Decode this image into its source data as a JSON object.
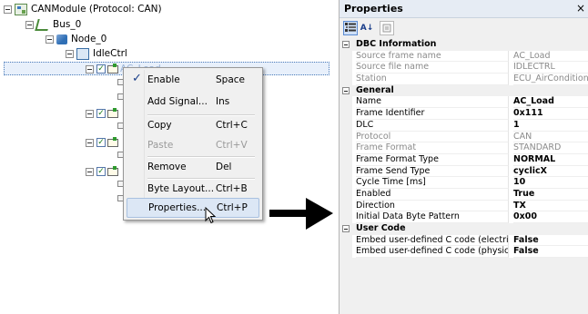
{
  "tree": {
    "root": "CANModule (Protocol: CAN)",
    "bus": "Bus_0",
    "node": "Node_0",
    "idle": "IdleCtrl",
    "frame_partial": "AC_Load"
  },
  "context_menu": {
    "items": [
      {
        "label": "Enable",
        "shortcut": "Space",
        "checked": true
      },
      {
        "label": "Add Signal...",
        "shortcut": "Ins"
      },
      {
        "label": "Copy",
        "shortcut": "Ctrl+C"
      },
      {
        "label": "Paste",
        "shortcut": "Ctrl+V",
        "disabled": true
      },
      {
        "label": "Remove",
        "shortcut": "Del"
      },
      {
        "label": "Byte Layout...",
        "shortcut": "Ctrl+B"
      },
      {
        "label": "Properties...",
        "shortcut": "Ctrl+P",
        "hover": true
      }
    ]
  },
  "properties": {
    "title": "Properties",
    "close": "×",
    "toolbar": {
      "categorized_icon": "categorized-icon",
      "alpha_icon": "sort-alpha-icon",
      "pages_icon": "property-pages-icon",
      "alpha_label": "A↓"
    },
    "categories": [
      {
        "name": "DBC Information",
        "rows": [
          {
            "name": "Source frame name",
            "value": "AC_Load",
            "readonly": true
          },
          {
            "name": "Source file name",
            "value": "IDLECTRL",
            "readonly": true
          },
          {
            "name": "Station",
            "value": "ECU_AirConditioner",
            "readonly": true
          }
        ]
      },
      {
        "name": "General",
        "rows": [
          {
            "name": "Name",
            "value": "AC_Load",
            "bold": true
          },
          {
            "name": "Frame Identifier",
            "value": "0x111",
            "bold": true
          },
          {
            "name": "DLC",
            "value": "1",
            "bold": true
          },
          {
            "name": "Protocol",
            "value": "CAN",
            "readonly": true
          },
          {
            "name": "Frame Format",
            "value": "STANDARD",
            "readonly": true
          },
          {
            "name": "Frame Format Type",
            "value": "NORMAL",
            "bold": true
          },
          {
            "name": "Frame Send Type",
            "value": "cyclicX",
            "bold": true
          },
          {
            "name": "Cycle Time [ms]",
            "value": "10",
            "bold": true
          },
          {
            "name": "Enabled",
            "value": "True",
            "bold": true
          },
          {
            "name": "Direction",
            "value": "TX",
            "bold": true
          },
          {
            "name": "Initial Data Byte Pattern",
            "value": "0x00",
            "bold": true
          }
        ]
      },
      {
        "name": "User Code",
        "rows": [
          {
            "name": "Embed user-defined C code (electrical)",
            "value": "False",
            "bold": true
          },
          {
            "name": "Embed user-defined C code (physical)",
            "value": "False",
            "bold": true
          }
        ]
      }
    ]
  },
  "colors": {
    "selection": "#e8f0fb",
    "menu_hover": "#dce7f5",
    "panel": "#f0f0f0"
  }
}
